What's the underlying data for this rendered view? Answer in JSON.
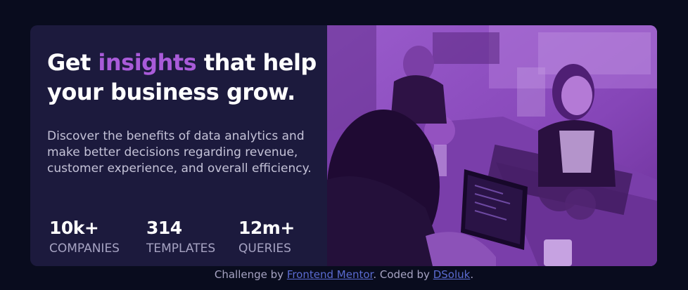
{
  "hero": {
    "headline_before": "Get ",
    "headline_accent": "insights",
    "headline_after": " that help your business grow.",
    "description": "Discover the benefits of data analytics and make better decisions regarding revenue, customer experience, and overall efficiency."
  },
  "stats": [
    {
      "value": "10k+",
      "label": "COMPANIES"
    },
    {
      "value": "314",
      "label": "TEMPLATES"
    },
    {
      "value": "12m+",
      "label": "QUERIES"
    }
  ],
  "image": {
    "icon": "office-team-photo",
    "tint_color": "#8e4fc0"
  },
  "footer": {
    "prefix": "Challenge by ",
    "link1": "Frontend Mentor",
    "middle": ". Coded by ",
    "link2": "DSoluk",
    "suffix": "."
  },
  "colors": {
    "background": "#090c1e",
    "card": "#1c1a3d",
    "accent": "#a95bd9",
    "link": "#5b6bd1"
  }
}
